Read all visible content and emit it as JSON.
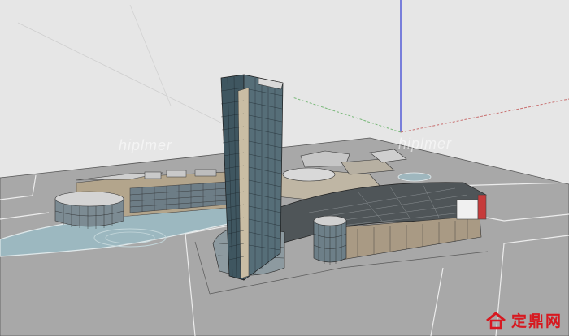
{
  "viewport": {
    "background": "#e6e6e6",
    "sky_color": "#e6e6e6",
    "ground_color": "#a8a8a8",
    "axis_colors": {
      "blue": "#4a52d6",
      "red": "#c87070",
      "green": "#79b879"
    }
  },
  "watermarks": {
    "left": "hiplmer",
    "right": "hiplmer"
  },
  "brand": {
    "text": "定鼎网",
    "color": "#d71920",
    "icon": "house-logo-icon"
  }
}
